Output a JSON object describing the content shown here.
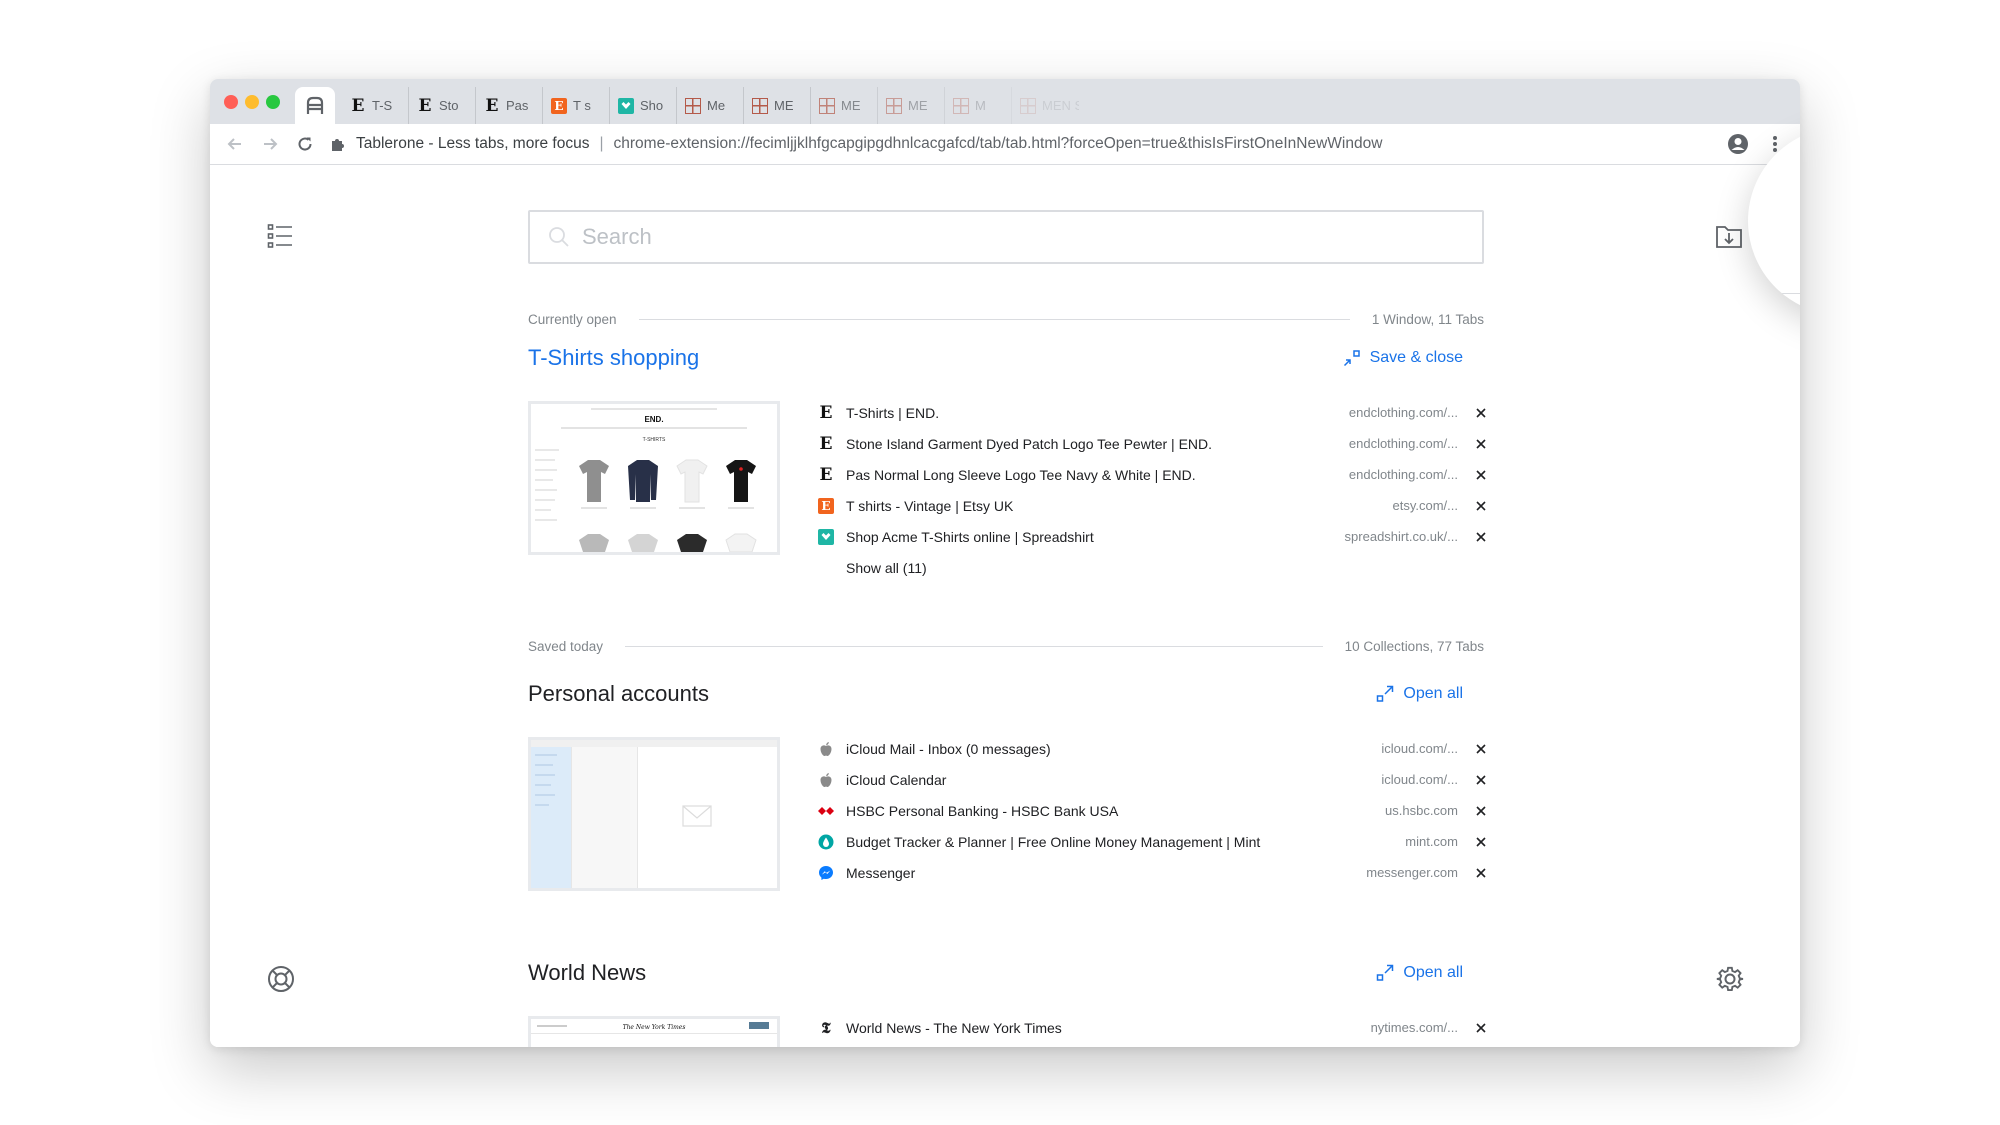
{
  "browser": {
    "active_tab_icon": "tablerone-icon",
    "tabs": [
      {
        "label": "T-S",
        "icon": "end-icon"
      },
      {
        "label": "Sto",
        "icon": "end-icon"
      },
      {
        "label": "Pas",
        "icon": "end-icon"
      },
      {
        "label": "T s",
        "icon": "etsy-icon"
      },
      {
        "label": "Sho",
        "icon": "spreadshirt-icon"
      },
      {
        "label": "Me",
        "icon": "grid-icon"
      },
      {
        "label": "ME",
        "icon": "grid-icon"
      },
      {
        "label": "ME",
        "icon": "grid-icon"
      },
      {
        "label": "ME",
        "icon": "grid-icon"
      },
      {
        "label": "M",
        "icon": "grid-icon"
      },
      {
        "label": "MEN SS",
        "icon": "grid-icon"
      }
    ],
    "page_title": "Tablerone - Less tabs, more focus",
    "url": "chrome-extension://fecimljjklhfgcapgipgdhnlcacgafcd/tab/tab.html?forceOpen=true&thisIsFirstOneInNewWindow"
  },
  "search": {
    "placeholder": "Search"
  },
  "currently_open": {
    "label": "Currently open",
    "summary": "1 Window, 11 Tabs",
    "collection": {
      "title": "T-Shirts shopping",
      "action": "Save & close",
      "tabs": [
        {
          "title": "T-Shirts | END.",
          "domain": "endclothing.com/...",
          "icon": "end-icon"
        },
        {
          "title": "Stone Island Garment Dyed Patch Logo Tee Pewter | END.",
          "domain": "endclothing.com/...",
          "icon": "end-icon"
        },
        {
          "title": "Pas Normal Long Sleeve Logo Tee Navy & White | END.",
          "domain": "endclothing.com/...",
          "icon": "end-icon"
        },
        {
          "title": "T shirts - Vintage | Etsy UK",
          "domain": "etsy.com/...",
          "icon": "etsy-icon"
        },
        {
          "title": "Shop Acme T-Shirts online | Spreadshirt",
          "domain": "spreadshirt.co.uk/...",
          "icon": "spreadshirt-icon"
        }
      ],
      "show_all": "Show all (11)",
      "thumbnail_brand": "END.",
      "thumbnail_heading": "T-SHIRTS"
    }
  },
  "saved_today": {
    "label": "Saved today",
    "summary": "10 Collections, 77 Tabs",
    "collections": [
      {
        "title": "Personal accounts",
        "action": "Open all",
        "tabs": [
          {
            "title": "iCloud Mail - Inbox (0 messages)",
            "domain": "icloud.com/...",
            "icon": "apple-icon"
          },
          {
            "title": "iCloud Calendar",
            "domain": "icloud.com/...",
            "icon": "apple-icon"
          },
          {
            "title": "HSBC Personal Banking - HSBC Bank USA",
            "domain": "us.hsbc.com",
            "icon": "hsbc-icon"
          },
          {
            "title": "Budget Tracker & Planner | Free Online Money Management | Mint",
            "domain": "mint.com",
            "icon": "mint-icon"
          },
          {
            "title": "Messenger",
            "domain": "messenger.com",
            "icon": "messenger-icon"
          }
        ]
      },
      {
        "title": "World News",
        "action": "Open all",
        "tabs": [
          {
            "title": "World News - The New York Times",
            "domain": "nytimes.com/...",
            "icon": "nyt-icon"
          }
        ],
        "thumbnail_masthead": "The New York Times"
      }
    ]
  },
  "colors": {
    "accent": "#1a73e8",
    "tabstrip": "#dee1e6",
    "muted_text": "#80868b",
    "etsy": "#f1641e",
    "spreadshirt": "#1fb6a5",
    "hsbc": "#db0011",
    "mint": "#00a6a4",
    "messenger": "#0a7cff"
  }
}
